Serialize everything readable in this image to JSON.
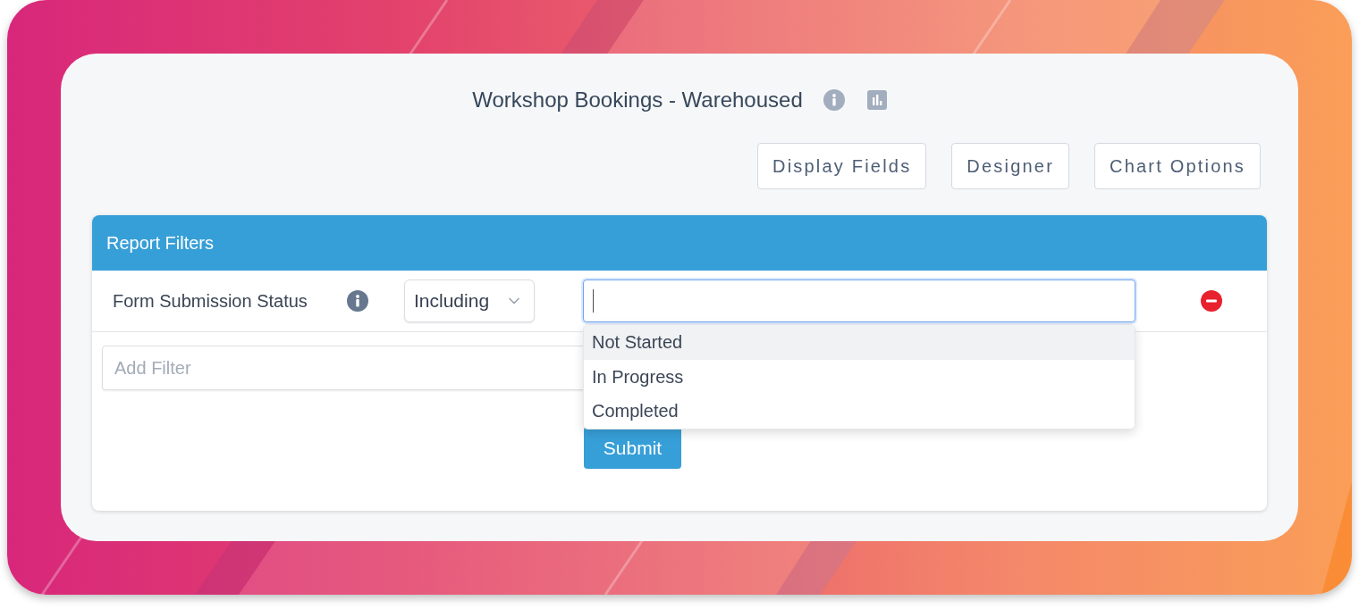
{
  "report": {
    "title": "Workshop Bookings - Warehoused"
  },
  "toolbar": {
    "buttons": [
      {
        "label": "Display Fields"
      },
      {
        "label": "Designer"
      },
      {
        "label": "Chart Options"
      }
    ]
  },
  "filters_panel": {
    "title": "Report Filters",
    "filters": [
      {
        "label": "Form Submission Status",
        "operator": "Including",
        "focused": true,
        "dropdown": {
          "open": true,
          "options": [
            {
              "label": "Not Started",
              "highlighted": true
            },
            {
              "label": "In Progress",
              "highlighted": false
            },
            {
              "label": "Completed",
              "highlighted": false
            }
          ]
        }
      }
    ],
    "add_filter": {
      "placeholder": "Add Filter"
    },
    "submit": "Submit"
  }
}
